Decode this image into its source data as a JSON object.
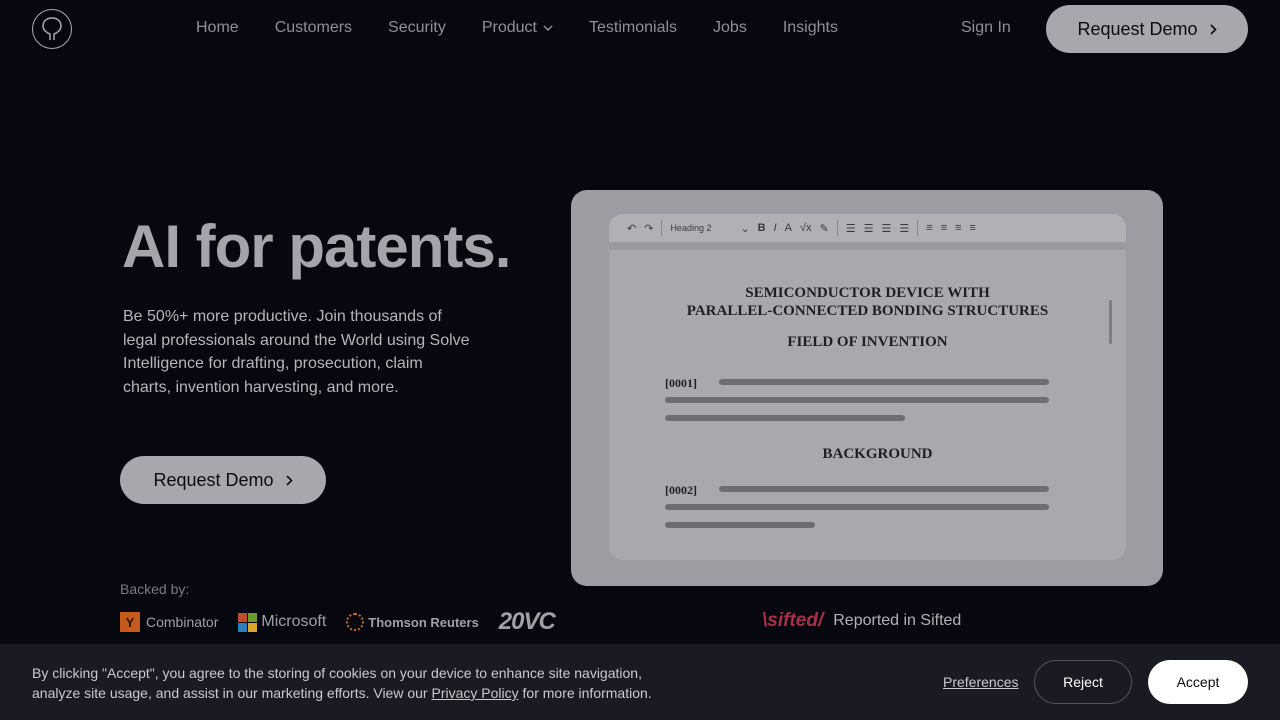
{
  "nav": {
    "links": [
      "Home",
      "Customers",
      "Security",
      "Product",
      "Testimonials",
      "Jobs",
      "Insights"
    ],
    "sign_in": "Sign In",
    "request_demo": "Request Demo"
  },
  "hero": {
    "title": "AI for patents.",
    "subtitle": "Be 50%+ more productive. Join thousands of legal professionals around the World using Solve Intelligence for drafting, prosecution, claim charts, invention harvesting, and more.",
    "cta": "Request Demo"
  },
  "backed": {
    "label": "Backed by:",
    "ycombinator": "Combinator",
    "ycombinator_letter": "Y",
    "microsoft": "Microsoft",
    "thomson": "Thomson Reuters",
    "twentyvc": "20VC"
  },
  "sifted": {
    "logo": "\\sifted/",
    "text": "Reported in Sifted"
  },
  "doc": {
    "style_label": "Heading 2",
    "title_line1": "SEMICONDUCTOR DEVICE WITH",
    "title_line2": "PARALLEL-CONNECTED BONDING STRUCTURES",
    "field": "FIELD OF INVENTION",
    "para1": "[0001]",
    "background": "BACKGROUND",
    "para2": "[0002]"
  },
  "cookie": {
    "text_before": "By clicking \"Accept\", you agree to the storing of cookies on your device to enhance site navigation, analyze site usage, and assist in our marketing efforts. View our ",
    "link": "Privacy Policy",
    "text_after": " for more information.",
    "preferences": "Preferences",
    "reject": "Reject",
    "accept": "Accept"
  },
  "colors": {
    "background": "#07080f",
    "button": "#a7a8ad",
    "cookie_bar": "#1a1b22",
    "sifted": "#a63049"
  }
}
